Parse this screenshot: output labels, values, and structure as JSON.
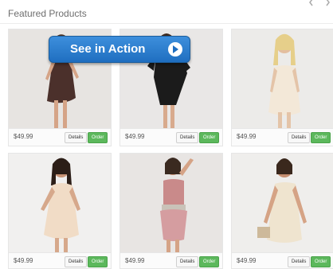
{
  "section": {
    "title": "Featured Products"
  },
  "cta": {
    "label": "See in Action"
  },
  "products": [
    {
      "price": "$49.99",
      "details_label": "Details",
      "order_label": "Order"
    },
    {
      "price": "$49.99",
      "details_label": "Details",
      "order_label": "Order"
    },
    {
      "price": "$49.99",
      "details_label": "Details",
      "order_label": "Order"
    },
    {
      "price": "$49.99",
      "details_label": "Details",
      "order_label": "Order"
    },
    {
      "price": "$49.99",
      "details_label": "Details",
      "order_label": "Order"
    },
    {
      "price": "$49.99",
      "details_label": "Details",
      "order_label": "Order"
    }
  ],
  "colors": {
    "order": "#5cb85c",
    "cta": "#2b7bd0"
  }
}
